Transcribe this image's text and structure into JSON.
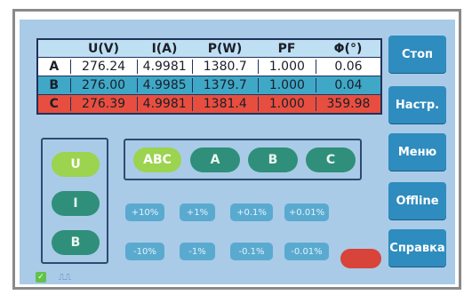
{
  "table": {
    "headers": [
      "",
      "U(V)",
      "I(A)",
      "P(W)",
      "PF",
      "Φ(°)"
    ],
    "rows": [
      {
        "phase": "A",
        "u": "276.24",
        "i": "4.9981",
        "p": "1380.7",
        "pf": "1.000",
        "phi": "0.06"
      },
      {
        "phase": "B",
        "u": "276.00",
        "i": "4.9985",
        "p": "1379.7",
        "pf": "1.000",
        "phi": "0.04"
      },
      {
        "phase": "C",
        "u": "276.39",
        "i": "4.9981",
        "p": "1381.4",
        "pf": "1.000",
        "phi": "359.98"
      }
    ]
  },
  "menu": {
    "stop": "Стоп",
    "settings": "Настр.",
    "menu": "Меню",
    "offline": "Offline",
    "help": "Справка"
  },
  "quantity": {
    "u": "U",
    "i": "I",
    "third": "B"
  },
  "phases": {
    "abc": "ABC",
    "a": "A",
    "b": "B",
    "c": "C"
  },
  "steps_up": [
    "+10%",
    "+1%",
    "+0.1%",
    "+0.01%"
  ],
  "steps_down": [
    "-10%",
    "-1%",
    "-0.1%",
    "-0.01%"
  ],
  "colors": {
    "screen_bg": "#a9cbe8",
    "button_blue": "#2e8cbf",
    "pill_green": "#2f8f7a",
    "pill_active": "#9cd34f",
    "phase_b": "#3fa8c7",
    "phase_c": "#e84e3f"
  }
}
